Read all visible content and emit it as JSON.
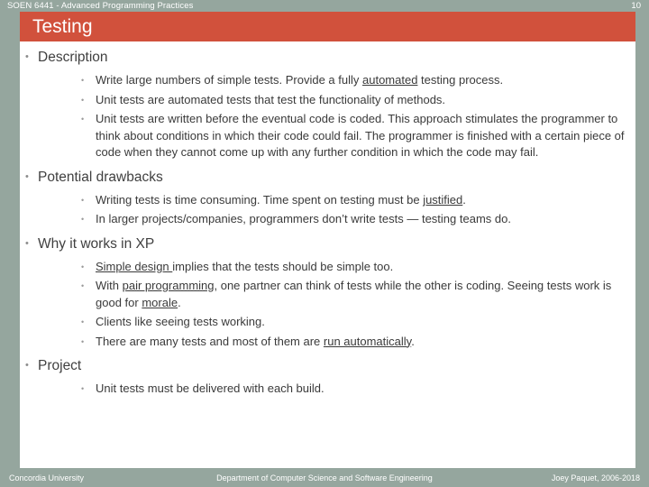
{
  "header": {
    "course": "SOEN 6441 - Advanced Programming Practices",
    "slide_number": "10"
  },
  "title": {
    "text": "Testing"
  },
  "colors": {
    "header_band": "#95a69e",
    "title_bar": "#d1513c",
    "body_text": "#404040",
    "slide_background": "#ffffff"
  },
  "sections": [
    {
      "heading": "Description",
      "items": [
        {
          "parts": [
            {
              "text": "Write large numbers of simple tests. Provide a fully ",
              "underline": false
            },
            {
              "text": "automated",
              "underline": true
            },
            {
              "text": " testing process.",
              "underline": false
            }
          ]
        },
        {
          "parts": [
            {
              "text": "Unit tests are automated tests that test the functionality of methods.",
              "underline": false
            }
          ]
        },
        {
          "parts": [
            {
              "text": "Unit tests are written before the eventual code is coded. This approach stimulates the programmer to think about conditions in which their code could fail. The programmer is finished with a certain piece of code when they cannot come up with any further condition in which the code may fail.",
              "underline": false
            }
          ]
        }
      ]
    },
    {
      "heading": "Potential drawbacks",
      "items": [
        {
          "parts": [
            {
              "text": "Writing tests is time consuming. Time spent on testing must be ",
              "underline": false
            },
            {
              "text": "justified",
              "underline": true
            },
            {
              "text": ".",
              "underline": false
            }
          ]
        },
        {
          "parts": [
            {
              "text": "In larger projects/companies, programmers don’t write tests — testing teams do.",
              "underline": false
            }
          ]
        }
      ]
    },
    {
      "heading": "Why it works in XP",
      "items": [
        {
          "parts": [
            {
              "text": "Simple design ",
              "underline": true
            },
            {
              "text": "implies that the tests should be simple too.",
              "underline": false
            }
          ]
        },
        {
          "parts": [
            {
              "text": "With ",
              "underline": false
            },
            {
              "text": "pair programming",
              "underline": true
            },
            {
              "text": ", one partner can think of tests while the other is coding. Seeing tests work is good for ",
              "underline": false
            },
            {
              "text": "morale",
              "underline": true
            },
            {
              "text": ".",
              "underline": false
            }
          ]
        },
        {
          "parts": [
            {
              "text": "Clients like seeing tests working.",
              "underline": false
            }
          ]
        },
        {
          "parts": [
            {
              "text": "There are many tests and most of them are ",
              "underline": false
            },
            {
              "text": "run automatically",
              "underline": true
            },
            {
              "text": ".",
              "underline": false
            }
          ]
        }
      ]
    },
    {
      "heading": "Project",
      "items": [
        {
          "parts": [
            {
              "text": "Unit tests must be delivered with each build.",
              "underline": false
            }
          ]
        }
      ]
    }
  ],
  "footer": {
    "left": "Concordia University",
    "center": "Department of Computer Science and Software Engineering",
    "right": "Joey Paquet, 2006-2018"
  }
}
